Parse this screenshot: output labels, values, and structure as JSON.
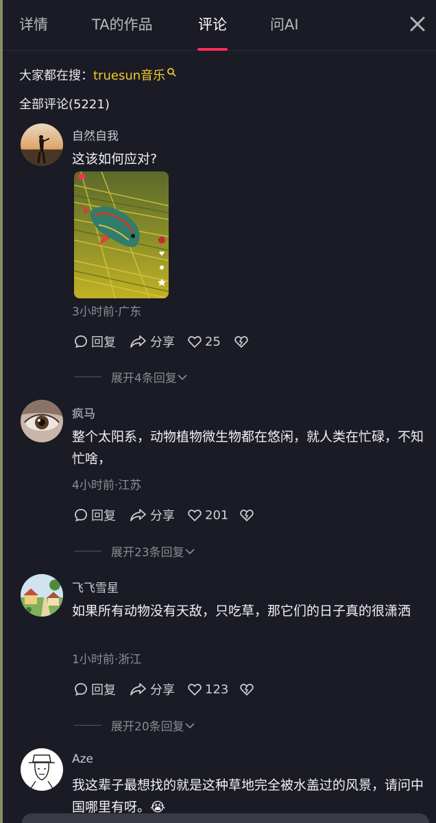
{
  "tabs": [
    {
      "label": "详情"
    },
    {
      "label": "TA的作品"
    },
    {
      "label": "评论"
    },
    {
      "label": "问AI"
    }
  ],
  "search_hint": {
    "prefix": "大家都在搜：",
    "keyword": "truesun音乐"
  },
  "total_label": "全部评论(5221)",
  "colors": {
    "accent": "#fe2c55",
    "keyword": "#f4cb2a",
    "background": "#1a1b24"
  },
  "comments": [
    {
      "username": "自然自我",
      "text": "这该如何应对?",
      "meta": "3小时前·广东",
      "reply_label": "回复",
      "share_label": "分享",
      "likes": "25",
      "expand": "展开4条回复"
    },
    {
      "username": "疯马",
      "text": "整个太阳系，动物植物微生物都在悠闲，就人类在忙碌，不知忙啥，",
      "meta": "4小时前·江苏",
      "reply_label": "回复",
      "share_label": "分享",
      "likes": "201",
      "expand": "展开23条回复"
    },
    {
      "username": "飞飞雪星",
      "text": "如果所有动物没有天敌，只吃草，那它们的日子真的很潇洒",
      "meta": "1小时前·浙江",
      "reply_label": "回复",
      "share_label": "分享",
      "likes": "123",
      "expand": "展开20条回复"
    },
    {
      "username": "Aze",
      "text": "我这辈子最想找的就是这种草地完全被水盖过的风景，请问中国哪里有呀。😭"
    }
  ]
}
